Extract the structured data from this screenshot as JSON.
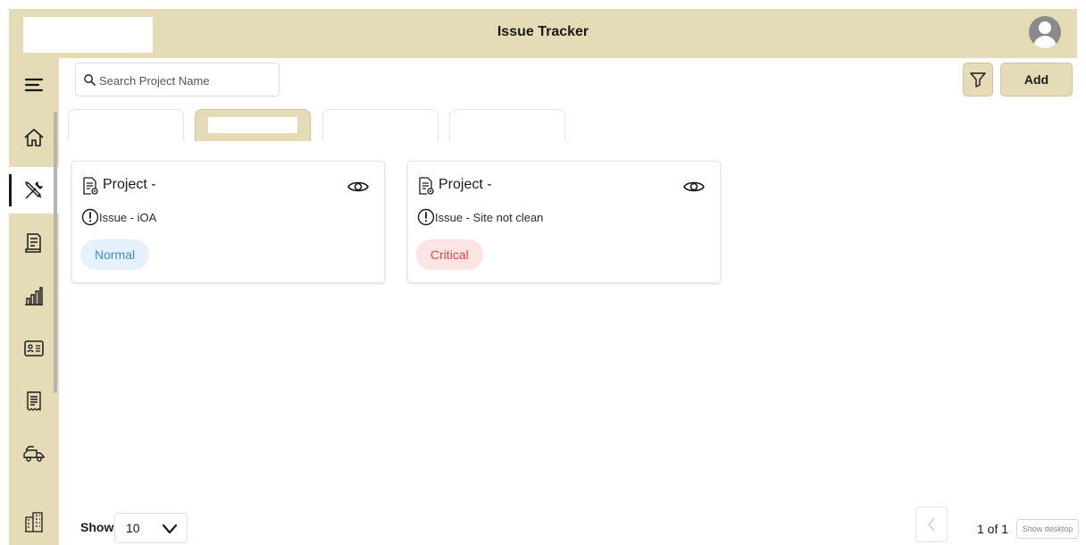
{
  "header": {
    "title": "Issue Tracker"
  },
  "sidebar": {
    "items": [
      {
        "icon": "menu-icon"
      },
      {
        "icon": "home-icon"
      },
      {
        "icon": "tools-icon",
        "active": true
      },
      {
        "icon": "document-icon"
      },
      {
        "icon": "bar-chart-icon"
      },
      {
        "icon": "id-card-icon"
      },
      {
        "icon": "receipt-icon"
      },
      {
        "icon": "truck-icon"
      },
      {
        "icon": "building-icon"
      }
    ]
  },
  "search": {
    "placeholder": "Search Project Name",
    "value": ""
  },
  "toolbar": {
    "add_label": "Add",
    "filter_icon": "filter-icon"
  },
  "cards": [
    {
      "project": "Project - ",
      "issue": "Issue - iOA",
      "priority": "Normal"
    },
    {
      "project": "Project - ",
      "issue": "Issue - Site not clean",
      "priority": "Critical"
    }
  ],
  "footer": {
    "show_label": "Show",
    "page_size": "10",
    "page_info": "1 of 1",
    "show_desktop": "Show desktop"
  },
  "colors": {
    "accent": "#e5dbb7",
    "normal_badge_bg": "#e6f1fb",
    "normal_badge_text": "#3b8ed4",
    "critical_badge_bg": "#fce4e4",
    "critical_badge_text": "#e04848"
  }
}
